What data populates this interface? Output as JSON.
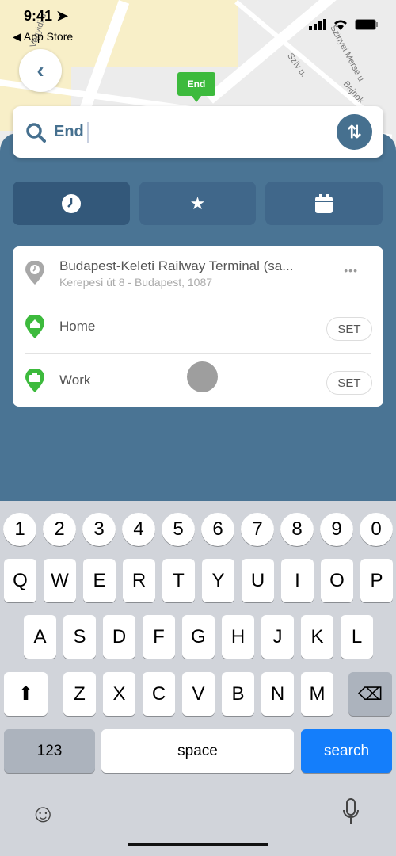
{
  "status_bar": {
    "time": "9:41",
    "back_app": "◀ App Store"
  },
  "map": {
    "pin_label": "End",
    "streets": [
      "Szív u.",
      "Szinyei Merse u",
      "Bajnok",
      "Vegyidi u"
    ]
  },
  "search": {
    "value": "End"
  },
  "tabs": [
    {
      "icon": "clock-icon",
      "active": true
    },
    {
      "icon": "star-icon",
      "active": false
    },
    {
      "icon": "calendar-icon",
      "active": false
    }
  ],
  "list": [
    {
      "name": "Budapest-Keleti Railway Terminal (sa...",
      "address": "Kerepesi út 8 - Budapest, 1087",
      "icon": "history-pin-icon",
      "action": "•••"
    },
    {
      "name": "Home",
      "icon": "home-pin-icon",
      "action": "SET"
    },
    {
      "name": "Work",
      "icon": "work-pin-icon",
      "action": "SET"
    }
  ],
  "keyboard": {
    "numbers": [
      "1",
      "2",
      "3",
      "4",
      "5",
      "6",
      "7",
      "8",
      "9",
      "0"
    ],
    "row1": [
      "Q",
      "W",
      "E",
      "R",
      "T",
      "Y",
      "U",
      "I",
      "O",
      "P"
    ],
    "row2": [
      "A",
      "S",
      "D",
      "F",
      "G",
      "H",
      "J",
      "K",
      "L"
    ],
    "row3": [
      "Z",
      "X",
      "C",
      "V",
      "B",
      "N",
      "M"
    ],
    "mode": "123",
    "space": "space",
    "action": "search"
  },
  "colors": {
    "brand": "#4a7494",
    "green": "#3dba3d",
    "search_key": "#147efb"
  }
}
